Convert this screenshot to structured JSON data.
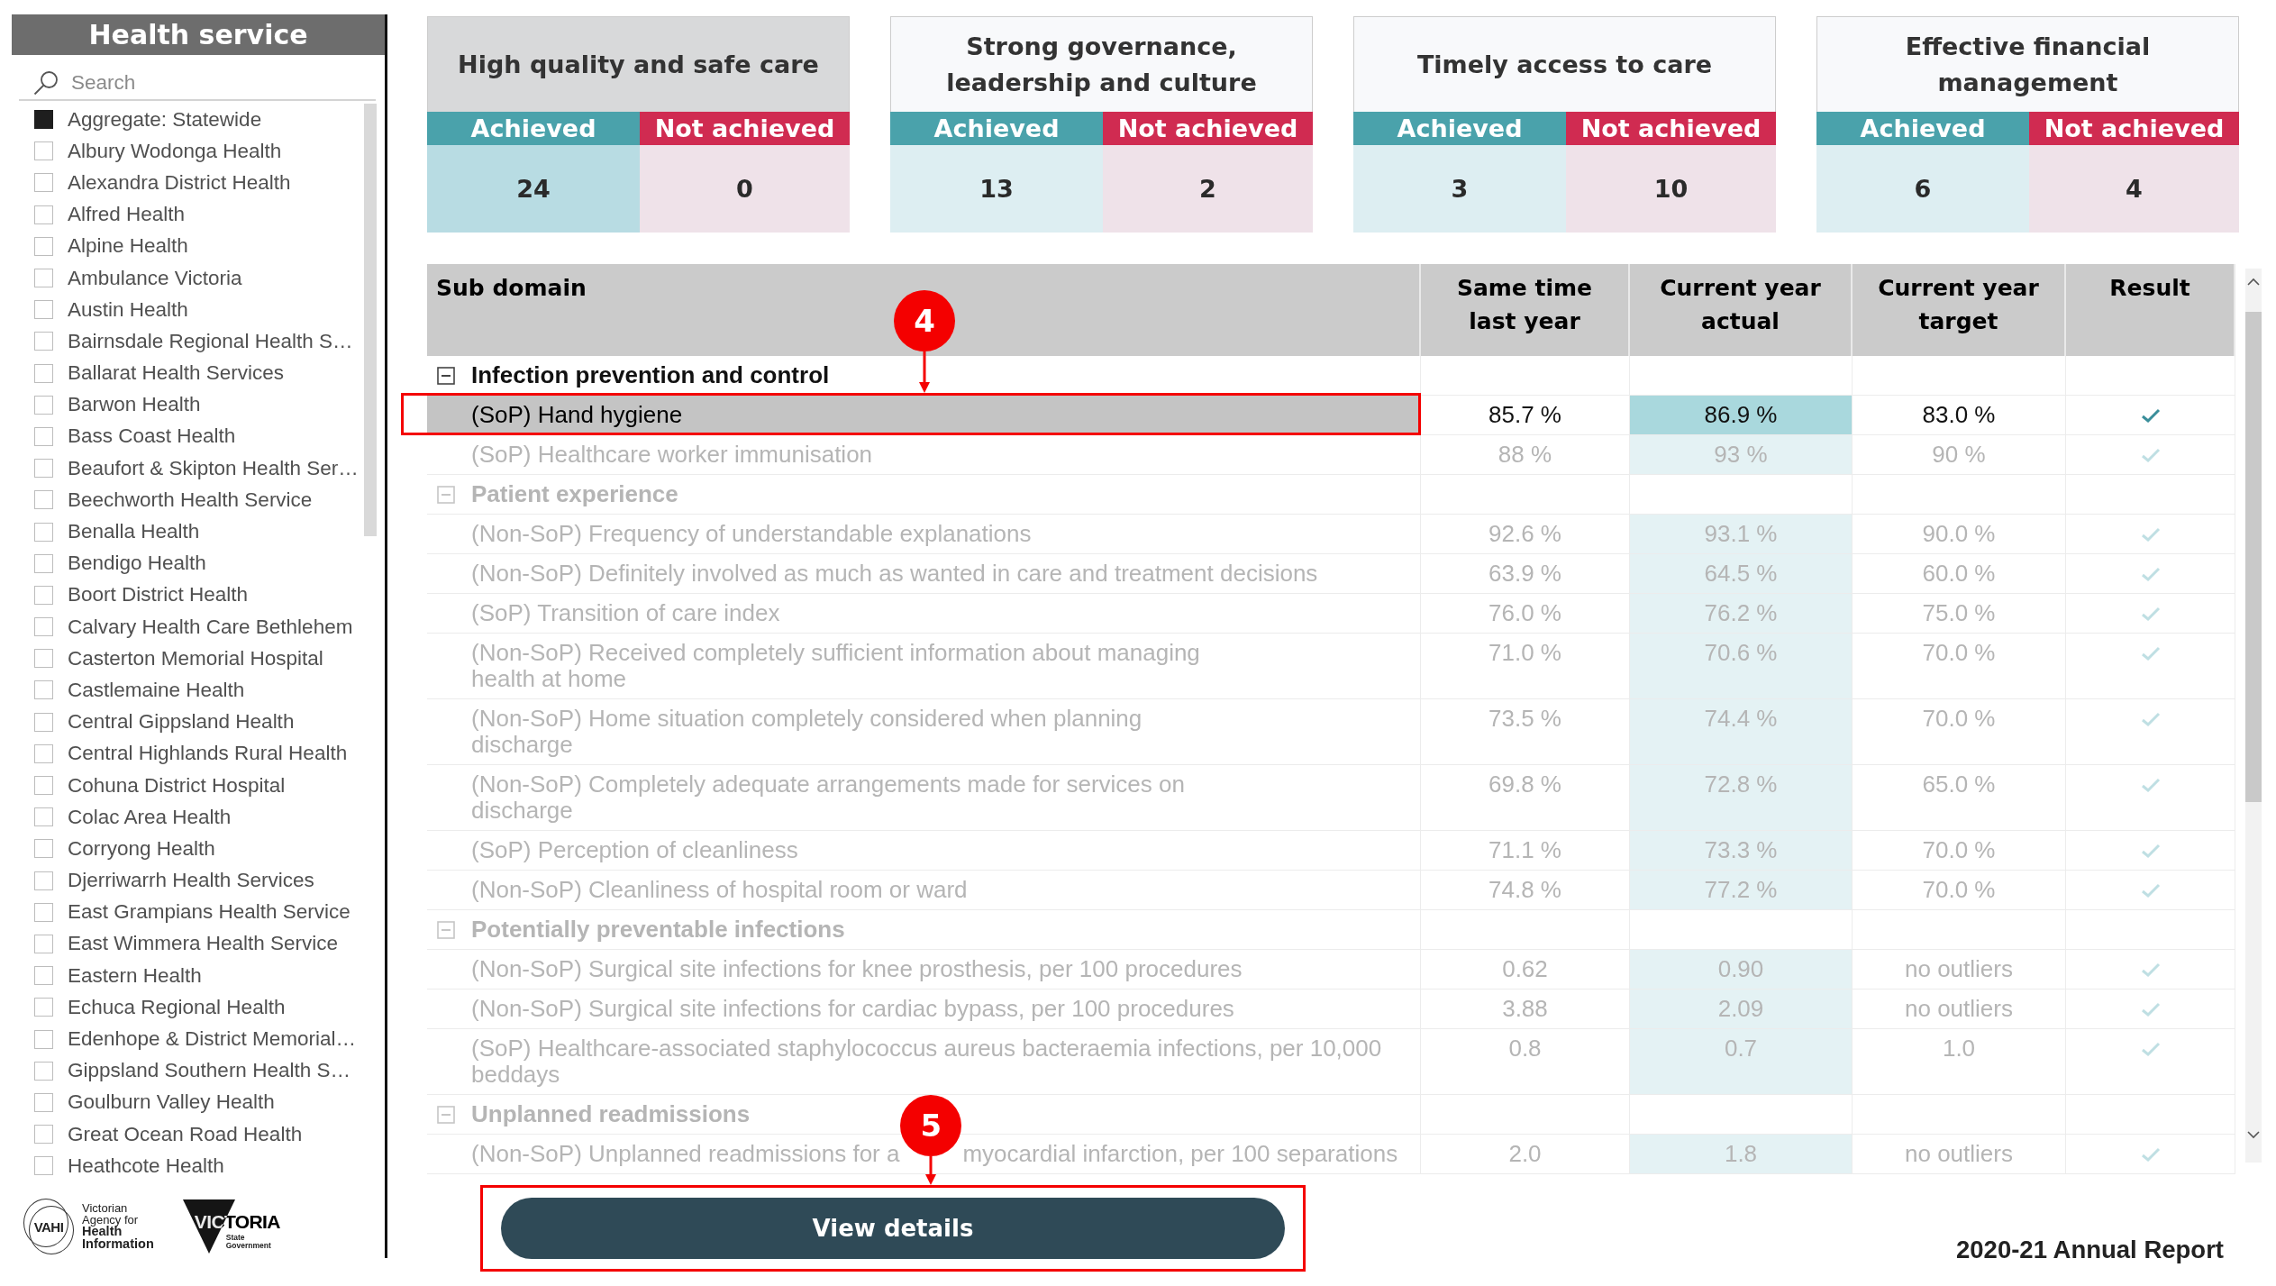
{
  "sidebar": {
    "title": "Health service",
    "search": {
      "placeholder": "Search"
    },
    "items": [
      {
        "label": "Aggregate: Statewide",
        "checked": true
      },
      {
        "label": "Albury Wodonga Health",
        "checked": false
      },
      {
        "label": "Alexandra District Health",
        "checked": false
      },
      {
        "label": "Alfred Health",
        "checked": false
      },
      {
        "label": "Alpine Health",
        "checked": false
      },
      {
        "label": "Ambulance Victoria",
        "checked": false
      },
      {
        "label": "Austin Health",
        "checked": false
      },
      {
        "label": "Bairnsdale Regional Health S…",
        "checked": false
      },
      {
        "label": "Ballarat Health Services",
        "checked": false
      },
      {
        "label": "Barwon Health",
        "checked": false
      },
      {
        "label": "Bass Coast Health",
        "checked": false
      },
      {
        "label": "Beaufort & Skipton Health Ser…",
        "checked": false
      },
      {
        "label": "Beechworth Health Service",
        "checked": false
      },
      {
        "label": "Benalla Health",
        "checked": false
      },
      {
        "label": "Bendigo Health",
        "checked": false
      },
      {
        "label": "Boort District Health",
        "checked": false
      },
      {
        "label": "Calvary Health Care Bethlehem",
        "checked": false
      },
      {
        "label": "Casterton Memorial Hospital",
        "checked": false
      },
      {
        "label": "Castlemaine Health",
        "checked": false
      },
      {
        "label": "Central Gippsland Health",
        "checked": false
      },
      {
        "label": "Central Highlands Rural Health",
        "checked": false
      },
      {
        "label": "Cohuna District Hospital",
        "checked": false
      },
      {
        "label": "Colac Area Health",
        "checked": false
      },
      {
        "label": "Corryong Health",
        "checked": false
      },
      {
        "label": "Djerriwarrh Health Services",
        "checked": false
      },
      {
        "label": "East Grampians Health Service",
        "checked": false
      },
      {
        "label": "East Wimmera Health Service",
        "checked": false
      },
      {
        "label": "Eastern Health",
        "checked": false
      },
      {
        "label": "Echuca Regional Health",
        "checked": false
      },
      {
        "label": "Edenhope & District Memorial…",
        "checked": false
      },
      {
        "label": "Gippsland Southern Health S…",
        "checked": false
      },
      {
        "label": "Goulburn Valley Health",
        "checked": false
      },
      {
        "label": "Great Ocean Road Health",
        "checked": false
      },
      {
        "label": "Heathcote Health",
        "checked": false
      }
    ],
    "logos": [
      {
        "kind": "ring",
        "mark": "VAHI",
        "text": "Victorian\nAgency for\n**Health**\n**Information**"
      },
      {
        "kind": "triangle",
        "mark": "VICTORIA",
        "text": "State\nGovernment"
      }
    ]
  },
  "domains": [
    {
      "title": "High quality and safe care",
      "selected": true,
      "achieved_label": "Achieved",
      "not_achieved_label": "Not achieved",
      "achieved": "24",
      "not_achieved": "0"
    },
    {
      "title": "Strong governance, leadership and culture",
      "selected": false,
      "achieved_label": "Achieved",
      "not_achieved_label": "Not achieved",
      "achieved": "13",
      "not_achieved": "2"
    },
    {
      "title": "Timely access to care",
      "selected": false,
      "achieved_label": "Achieved",
      "not_achieved_label": "Not achieved",
      "achieved": "3",
      "not_achieved": "10"
    },
    {
      "title": "Effective financial management",
      "selected": false,
      "achieved_label": "Achieved",
      "not_achieved_label": "Not achieved",
      "achieved": "6",
      "not_achieved": "4"
    }
  ],
  "table": {
    "columns": [
      "Sub domain",
      "Same time last year",
      "Current year actual",
      "Current year target",
      "Result"
    ],
    "groups": [
      {
        "label": "Infection prevention and control",
        "expanded": true,
        "children": [
          {
            "label": "(SoP) Hand hygiene",
            "last_year": "85.7 %",
            "actual": "86.9 %",
            "target": "83.0 %",
            "met": true,
            "selected": true
          },
          {
            "label": "(SoP) Healthcare worker immunisation",
            "last_year": "88 %",
            "actual": "93 %",
            "target": "90 %",
            "met": true,
            "selected": false
          }
        ]
      },
      {
        "label": "Patient experience",
        "expanded": true,
        "children": [
          {
            "label": "(Non-SoP) Frequency of understandable explanations",
            "last_year": "92.6 %",
            "actual": "93.1 %",
            "target": "90.0 %",
            "met": true,
            "selected": false
          },
          {
            "label": "(Non-SoP) Definitely involved as much as wanted in care and treatment decisions",
            "last_year": "63.9 %",
            "actual": "64.5 %",
            "target": "60.0 %",
            "met": true,
            "selected": false
          },
          {
            "label": "(SoP) Transition of care index",
            "last_year": "76.0 %",
            "actual": "76.2 %",
            "target": "75.0 %",
            "met": true,
            "selected": false
          },
          {
            "label": "(Non-SoP) Received completely sufficient information about managing\nhealth at home",
            "last_year": "71.0 %",
            "actual": "70.6 %",
            "target": "70.0 %",
            "met": true,
            "selected": false
          },
          {
            "label": "(Non-SoP) Home situation completely considered when planning\ndischarge",
            "last_year": "73.5 %",
            "actual": "74.4 %",
            "target": "70.0 %",
            "met": true,
            "selected": false
          },
          {
            "label": "(Non-SoP) Completely adequate arrangements made for services on\ndischarge",
            "last_year": "69.8 %",
            "actual": "72.8 %",
            "target": "65.0 %",
            "met": true,
            "selected": false
          },
          {
            "label": "(SoP) Perception of cleanliness",
            "last_year": "71.1 %",
            "actual": "73.3 %",
            "target": "70.0 %",
            "met": true,
            "selected": false
          },
          {
            "label": "(Non-SoP) Cleanliness of hospital room or ward",
            "last_year": "74.8 %",
            "actual": "77.2 %",
            "target": "70.0 %",
            "met": true,
            "selected": false
          }
        ]
      },
      {
        "label": "Potentially preventable infections",
        "expanded": true,
        "children": [
          {
            "label": "(Non-SoP) Surgical site infections for knee prosthesis, per 100 procedures",
            "last_year": "0.62",
            "actual": "0.90",
            "target": "no outliers",
            "met": true,
            "selected": false
          },
          {
            "label": "(Non-SoP) Surgical site infections for cardiac bypass, per 100 procedures",
            "last_year": "3.88",
            "actual": "2.09",
            "target": "no outliers",
            "met": true,
            "selected": false
          },
          {
            "label": "(SoP) Healthcare-associated staphylococcus aureus bacteraemia infections, per 10,000\nbeddays",
            "last_year": "0.8",
            "actual": "0.7",
            "target": "1.0",
            "met": true,
            "selected": false
          }
        ]
      },
      {
        "label": "Unplanned readmissions",
        "expanded": true,
        "children": [
          {
            "label_parts": [
              "(Non-SoP) Unplanned readmissions for a",
              "myocardial infarction, per 100 separations"
            ],
            "last_year": "2.0",
            "actual": "1.8",
            "target": "no outliers",
            "met": true,
            "selected": false
          }
        ]
      }
    ]
  },
  "callouts": [
    {
      "number": "4"
    },
    {
      "number": "5"
    }
  ],
  "view_details": "View details",
  "footer": "2020-21 Annual Report"
}
